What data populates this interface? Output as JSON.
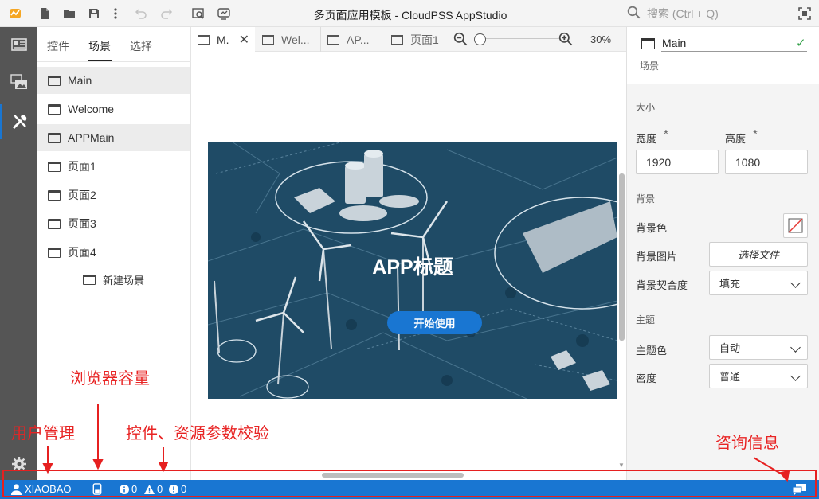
{
  "window": {
    "title": "多页面应用模板 - CloudPSS AppStudio",
    "search_placeholder": "搜索 (Ctrl + Q)"
  },
  "toolbar": {
    "icons": [
      "logo-icon",
      "new-file-icon",
      "open-folder-icon",
      "save-icon",
      "more-icon",
      "undo-icon",
      "redo-icon",
      "preview-icon",
      "screenshot-icon"
    ]
  },
  "left_panel": {
    "tabs": [
      "控件",
      "场景",
      "选择"
    ],
    "active_tab": "场景",
    "scenes": [
      "Main",
      "Welcome",
      "APPMain",
      "页面1",
      "页面2",
      "页面3",
      "页面4"
    ],
    "new_scene": "新建场景"
  },
  "doc_tabs": [
    "M.",
    "Wel...",
    "AP...",
    "页面1"
  ],
  "zoom": "30%",
  "preview": {
    "title": "APP标题",
    "button": "开始使用"
  },
  "properties": {
    "name": "Main",
    "type": "场景",
    "size_section": "大小",
    "width_label": "宽度",
    "width_value": "1920",
    "height_label": "高度",
    "height_value": "1080",
    "required_mark": "*",
    "bg_section": "背景",
    "bg_color_label": "背景色",
    "bg_image_label": "背景图片",
    "bg_image_button": "选择文件",
    "bg_fit_label": "背景契合度",
    "bg_fit_value": "填充",
    "theme_section": "主题",
    "theme_color_label": "主题色",
    "theme_color_value": "自动",
    "density_label": "密度",
    "density_value": "普通"
  },
  "status": {
    "user": "XIAOBAO",
    "info_count": "0",
    "warning_count": "0",
    "error_count": "0"
  },
  "annotations": {
    "user_mgmt": "用户管理",
    "browser_capacity": "浏览器容量",
    "validation": "控件、资源参数校验",
    "consult": "咨询信息"
  },
  "colors": {
    "accent": "#1976d2",
    "annotation": "#e62020",
    "check": "#2e9e44"
  }
}
